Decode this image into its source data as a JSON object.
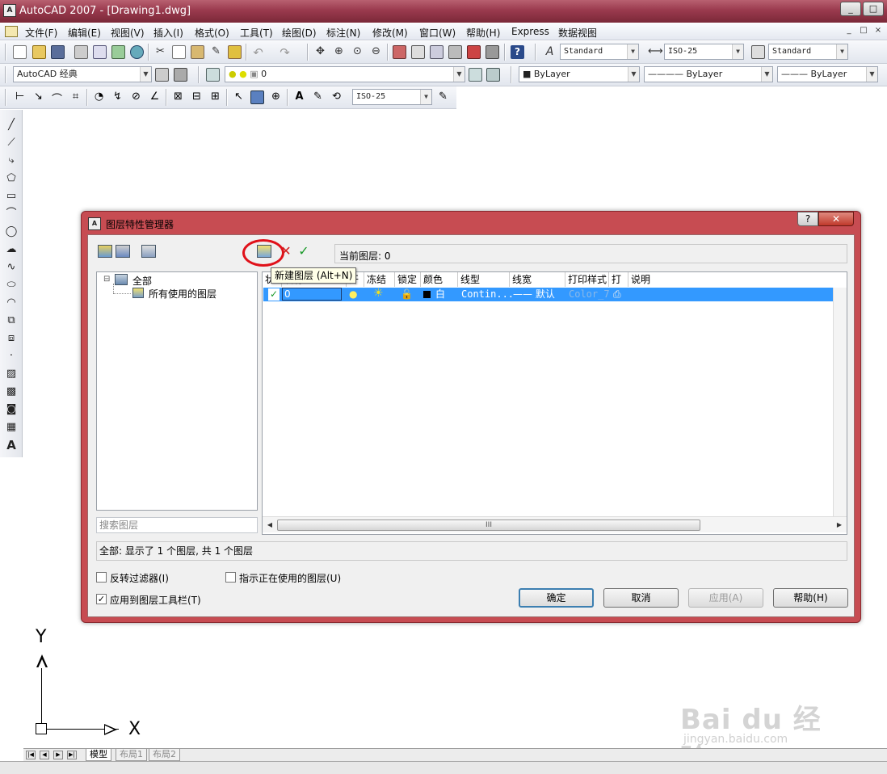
{
  "app": {
    "title": "AutoCAD 2007 - [Drawing1.dwg]",
    "window_buttons": [
      "_",
      "□",
      "✕"
    ]
  },
  "menubar": {
    "items": [
      "文件(F)",
      "编辑(E)",
      "视图(V)",
      "插入(I)",
      "格式(O)",
      "工具(T)",
      "绘图(D)",
      "标注(N)",
      "修改(M)",
      "窗口(W)",
      "帮助(H)",
      "Express",
      "数据视图"
    ],
    "doc_buttons": [
      "_",
      "□",
      "×"
    ]
  },
  "toolbar1": {
    "text_style": "Standard",
    "dim_style": "ISO-25",
    "table_style": "Standard"
  },
  "toolbar2": {
    "workspace": "AutoCAD 经典",
    "layer": "0",
    "color": "■ ByLayer",
    "linetype": "———— ByLayer",
    "lineweight": "——— ByLayer"
  },
  "toolbar3": {
    "dim_style": "ISO-25"
  },
  "left_toolbar": {
    "text_tool": "A"
  },
  "tabs": {
    "items": [
      "模型",
      "布局1",
      "布局2"
    ],
    "active": 0,
    "nav": [
      "|◀",
      "◀",
      "▶",
      "▶|"
    ]
  },
  "ucs": {
    "y_label": "Y",
    "x_label": "X"
  },
  "watermark": {
    "brand": "Bai du 经验",
    "url": "jingyan.baidu.com"
  },
  "dialog": {
    "title": "图层特性管理器",
    "help_button": "?",
    "close_button": "✕",
    "current_layer_label": "当前图层: 0",
    "tooltip": "新建图层 (Alt+N)",
    "tree": {
      "root": "全部",
      "child": "所有使用的图层",
      "expander": "⊟"
    },
    "search_placeholder": "搜索图层",
    "columns": [
      "状",
      "名称",
      "开",
      "冻结",
      "锁定",
      "颜色",
      "线型",
      "线宽",
      "打印样式",
      "打",
      "说明"
    ],
    "rows": [
      {
        "status": "✓",
        "name": "0",
        "color": "白",
        "linetype": "Contin...",
        "lineweight": "—— 默认",
        "plot_style": "Color_7"
      }
    ],
    "scrollbar_grip": "III",
    "summary": "全部: 显示了 1 个图层, 共 1 个图层",
    "invert_filter": "反转过滤器(I)",
    "indicate_in_use": "指示正在使用的图层(U)",
    "apply_to_toolbar": "应用到图层工具栏(T)",
    "buttons": {
      "ok": "确定",
      "cancel": "取消",
      "apply": "应用(A)",
      "help": "帮助(H)"
    }
  }
}
